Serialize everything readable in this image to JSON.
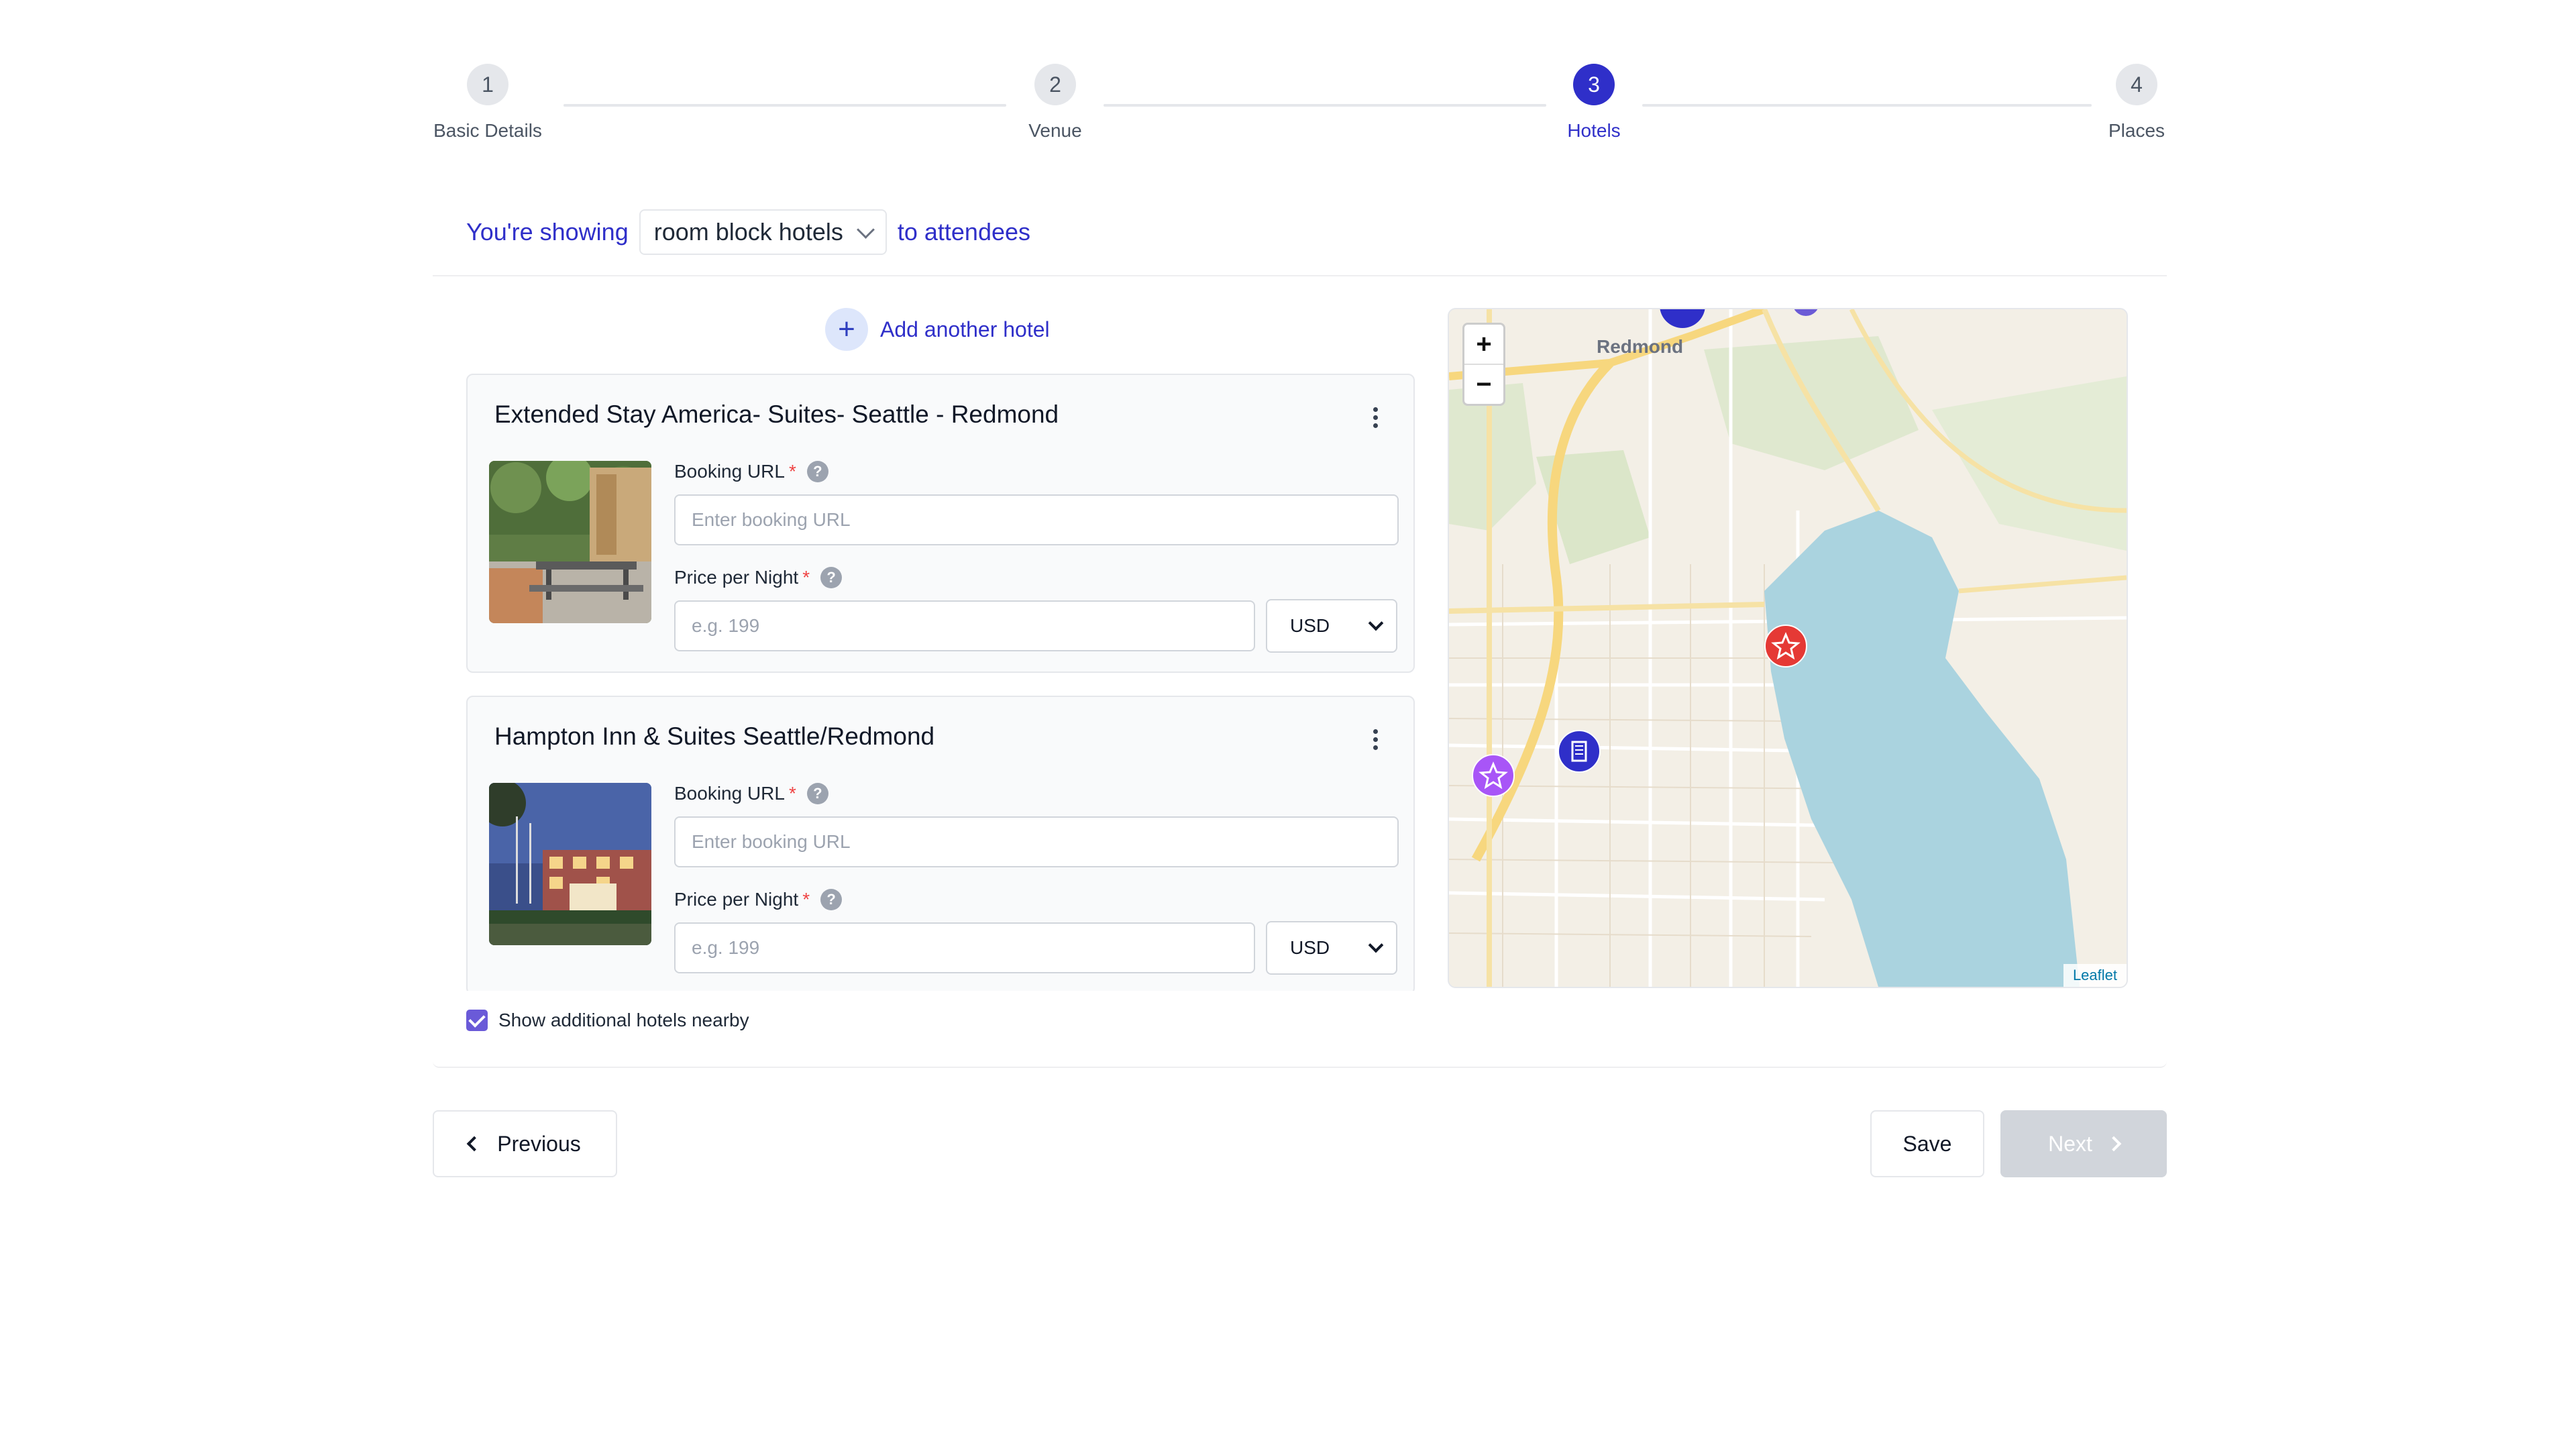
{
  "stepper": {
    "steps": [
      {
        "number": "1",
        "label": "Basic Details",
        "state": "inactive"
      },
      {
        "number": "2",
        "label": "Venue",
        "state": "inactive"
      },
      {
        "number": "3",
        "label": "Hotels",
        "state": "active"
      },
      {
        "number": "4",
        "label": "Places",
        "state": "inactive"
      }
    ],
    "active_color": "#2f2fc9"
  },
  "display_mode": {
    "prefix": "You're showing",
    "selected": "room block hotels",
    "suffix": "to attendees"
  },
  "add_hotel": {
    "label": "Add another hotel"
  },
  "hotels": [
    {
      "name": "Extended Stay America- Suites- Seattle - Redmond",
      "photo_icon": "patio-photo",
      "booking_url_label": "Booking URL",
      "booking_url_placeholder": "Enter booking URL",
      "booking_url_value": "",
      "price_label": "Price per Night",
      "price_placeholder": "e.g. 199",
      "price_value": "",
      "currency": "USD"
    },
    {
      "name": "Hampton Inn & Suites Seattle/Redmond",
      "photo_icon": "hotel-exterior-photo",
      "booking_url_label": "Booking URL",
      "booking_url_placeholder": "Enter booking URL",
      "booking_url_value": "",
      "price_label": "Price per Night",
      "price_placeholder": "e.g. 199",
      "price_value": "",
      "currency": "USD"
    }
  ],
  "required_marker": "*",
  "help_glyph": "?",
  "show_nearby": {
    "label": "Show additional hotels nearby",
    "checked": true
  },
  "map": {
    "place_label": "Redmond",
    "zoom_in": "+",
    "zoom_out": "−",
    "attribution": "Leaflet",
    "markers": [
      {
        "kind": "venue-star",
        "color": "#e53935"
      },
      {
        "kind": "hotel-building",
        "color": "#2f2fc9"
      },
      {
        "kind": "place-star",
        "color": "#a855f7"
      }
    ],
    "water_color": "#aad3df",
    "land_color": "#f3efe6"
  },
  "footer": {
    "previous_label": "Previous",
    "save_label": "Save",
    "next_label": "Next",
    "next_disabled": true
  }
}
